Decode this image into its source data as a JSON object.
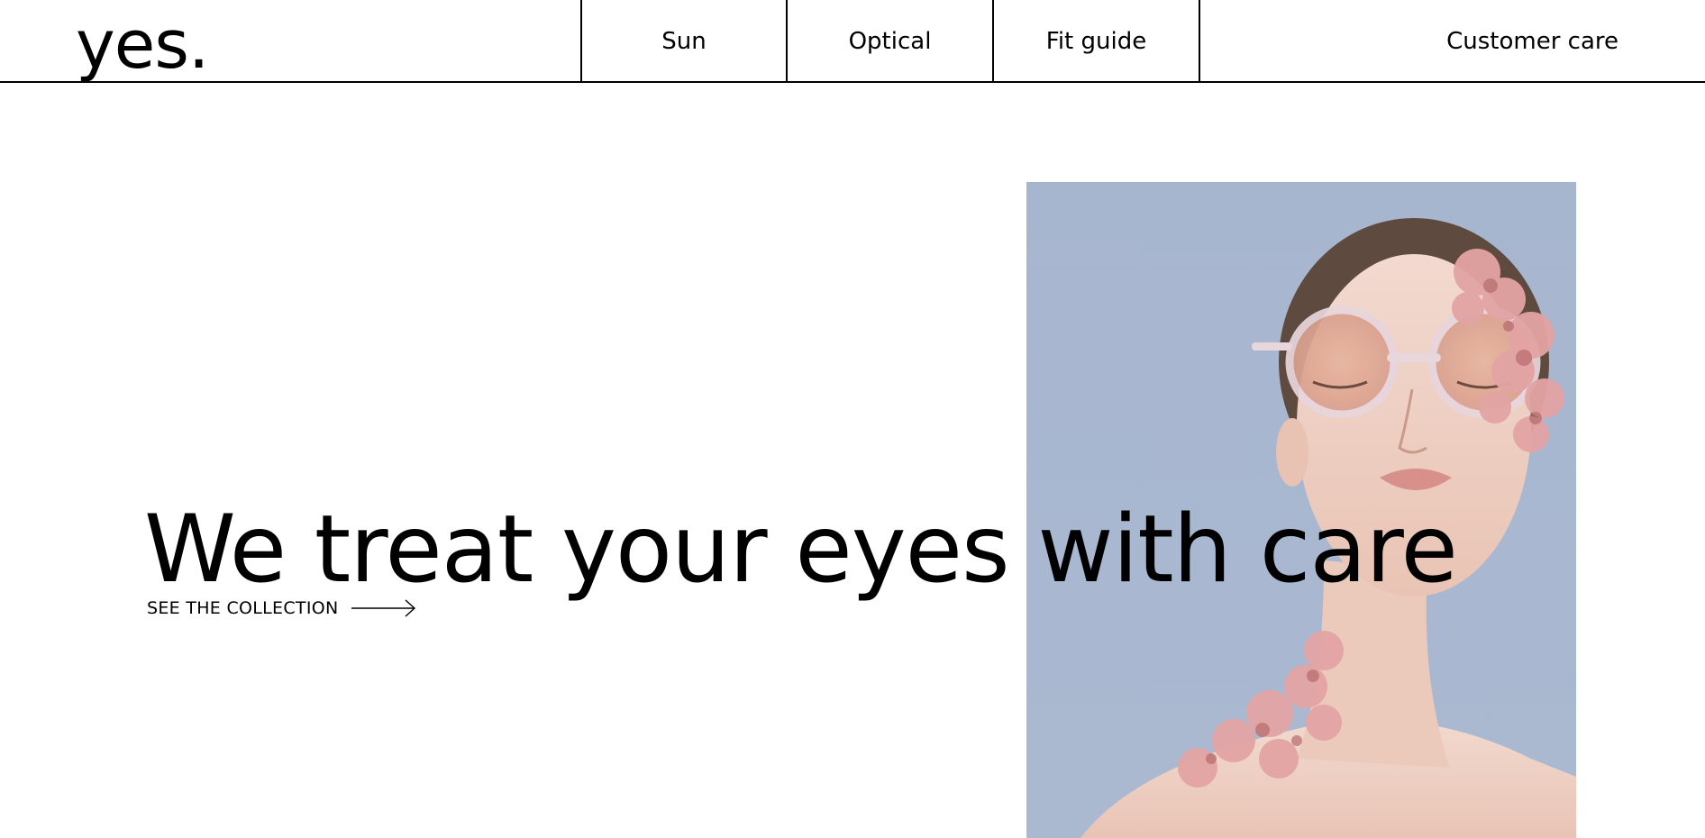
{
  "brand": {
    "logo_text": "yes."
  },
  "nav": {
    "items": [
      {
        "label": "Sun"
      },
      {
        "label": "Optical"
      },
      {
        "label": "Fit guide"
      }
    ],
    "customer_care": "Customer care"
  },
  "hero": {
    "title": "We treat your eyes with care",
    "cta_label": "SEE THE COLLECTION",
    "image_alt": "Model wearing clear round sunglasses with pink carnation petals on face and shoulder"
  },
  "colors": {
    "text": "#000000",
    "background": "#ffffff",
    "photo_backdrop": "#a9b8d0",
    "petal_pink": "#e3a4a4"
  },
  "icons": {
    "cta_arrow": "long-right-arrow-icon"
  }
}
